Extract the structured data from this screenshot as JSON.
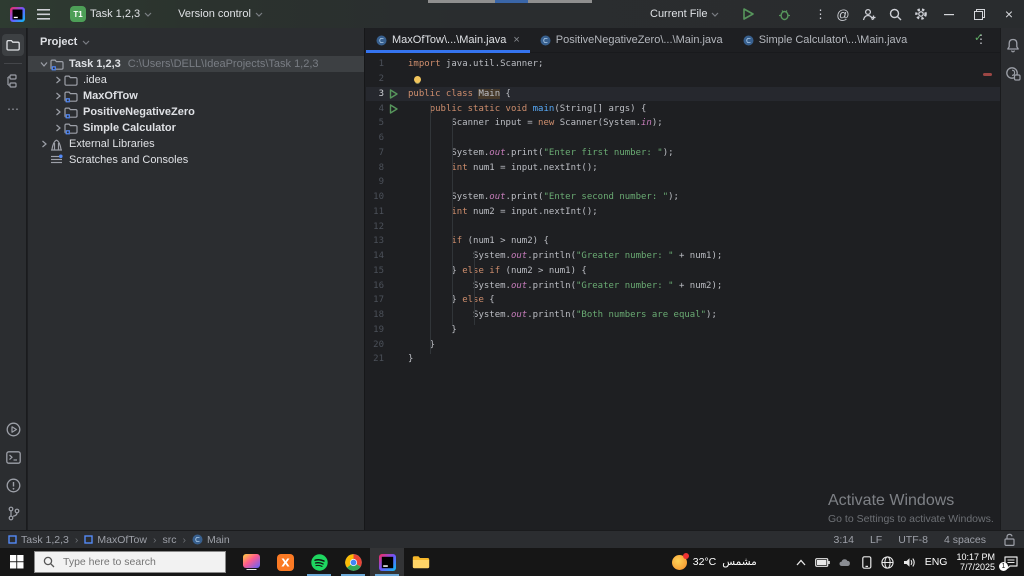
{
  "window": {
    "project_badge": "T1",
    "title_project": "Task 1,2,3",
    "version_control": "Version control",
    "run_config": "Current File",
    "activate_title": "Activate Windows",
    "activate_sub": "Go to Settings to activate Windows.",
    "inspection_check": "✓",
    "kebab": "⋮",
    "more_dots": "⋯",
    "minimize": "—",
    "close": "×"
  },
  "tabs": [
    {
      "label": "MaxOfTow\\...\\Main.java",
      "active": true,
      "closable": true
    },
    {
      "label": "PositiveNegativeZero\\...\\Main.java",
      "active": false,
      "closable": false
    },
    {
      "label": "Simple Calculator\\...\\Main.java",
      "active": false,
      "closable": false
    }
  ],
  "project": {
    "header": "Project",
    "items": [
      {
        "label": "Task 1,2,3",
        "path": "C:\\Users\\DELL\\IdeaProjects\\Task 1,2,3",
        "depth": 0,
        "chevron": "down",
        "icon": "module-folder",
        "bold": true,
        "selected": true
      },
      {
        "label": ".idea",
        "path": "",
        "depth": 1,
        "chevron": "right",
        "icon": "folder",
        "bold": false,
        "selected": false
      },
      {
        "label": "MaxOfTow",
        "path": "",
        "depth": 1,
        "chevron": "right",
        "icon": "module-folder",
        "bold": true,
        "selected": false
      },
      {
        "label": "PositiveNegativeZero",
        "path": "",
        "depth": 1,
        "chevron": "right",
        "icon": "module-folder",
        "bold": true,
        "selected": false
      },
      {
        "label": "Simple Calculator",
        "path": "",
        "depth": 1,
        "chevron": "right",
        "icon": "module-folder",
        "bold": true,
        "selected": false
      },
      {
        "label": "External Libraries",
        "path": "",
        "depth": 0,
        "chevron": "right",
        "icon": "library",
        "bold": false,
        "selected": false
      },
      {
        "label": "Scratches and Consoles",
        "path": "",
        "depth": 0,
        "chevron": "none",
        "icon": "scratch",
        "bold": false,
        "selected": false
      }
    ]
  },
  "editor": {
    "lines": [
      {
        "n": 1,
        "tokens": [
          [
            "k",
            "import"
          ],
          [
            "d",
            " java.util.Scanner;"
          ]
        ]
      },
      {
        "n": 2,
        "bulb": true,
        "tokens": []
      },
      {
        "n": 3,
        "run": true,
        "current": true,
        "tokens": [
          [
            "k",
            "public class "
          ],
          [
            "hl",
            "Main"
          ],
          [
            "d",
            " {"
          ]
        ]
      },
      {
        "n": 4,
        "run": true,
        "tokens": [
          [
            "d",
            "    "
          ],
          [
            "k",
            "public static void "
          ],
          [
            "m",
            "main"
          ],
          [
            "d",
            "(String[] args) {"
          ]
        ]
      },
      {
        "n": 5,
        "tokens": [
          [
            "d",
            "        Scanner input = "
          ],
          [
            "k",
            "new"
          ],
          [
            "d",
            " Scanner(System."
          ],
          [
            "f",
            "in"
          ],
          [
            "d",
            ");"
          ]
        ]
      },
      {
        "n": 6,
        "tokens": []
      },
      {
        "n": 7,
        "tokens": [
          [
            "d",
            "        System."
          ],
          [
            "f",
            "out"
          ],
          [
            "d",
            ".print("
          ],
          [
            "s",
            "\"Enter first number: \""
          ],
          [
            "d",
            ");"
          ]
        ]
      },
      {
        "n": 8,
        "tokens": [
          [
            "d",
            "        "
          ],
          [
            "k",
            "int"
          ],
          [
            "d",
            " num1 = input.nextInt();"
          ]
        ]
      },
      {
        "n": 9,
        "tokens": []
      },
      {
        "n": 10,
        "tokens": [
          [
            "d",
            "        System."
          ],
          [
            "f",
            "out"
          ],
          [
            "d",
            ".print("
          ],
          [
            "s",
            "\"Enter second number: \""
          ],
          [
            "d",
            ");"
          ]
        ]
      },
      {
        "n": 11,
        "tokens": [
          [
            "d",
            "        "
          ],
          [
            "k",
            "int"
          ],
          [
            "d",
            " num2 = input.nextInt();"
          ]
        ]
      },
      {
        "n": 12,
        "tokens": []
      },
      {
        "n": 13,
        "tokens": [
          [
            "d",
            "        "
          ],
          [
            "k",
            "if"
          ],
          [
            "d",
            " (num1 > num2) {"
          ]
        ]
      },
      {
        "n": 14,
        "tokens": [
          [
            "d",
            "            System."
          ],
          [
            "f",
            "out"
          ],
          [
            "d",
            ".println("
          ],
          [
            "s",
            "\"Greater number: \""
          ],
          [
            "d",
            " + num1);"
          ]
        ]
      },
      {
        "n": 15,
        "tokens": [
          [
            "d",
            "        } "
          ],
          [
            "k",
            "else if"
          ],
          [
            "d",
            " (num2 > num1) {"
          ]
        ]
      },
      {
        "n": 16,
        "tokens": [
          [
            "d",
            "            System."
          ],
          [
            "f",
            "out"
          ],
          [
            "d",
            ".println("
          ],
          [
            "s",
            "\"Greater number: \""
          ],
          [
            "d",
            " + num2);"
          ]
        ]
      },
      {
        "n": 17,
        "tokens": [
          [
            "d",
            "        } "
          ],
          [
            "k",
            "else"
          ],
          [
            "d",
            " {"
          ]
        ]
      },
      {
        "n": 18,
        "tokens": [
          [
            "d",
            "            System."
          ],
          [
            "f",
            "out"
          ],
          [
            "d",
            ".println("
          ],
          [
            "s",
            "\"Both numbers are equal\""
          ],
          [
            "d",
            ");"
          ]
        ]
      },
      {
        "n": 19,
        "tokens": [
          [
            "d",
            "        }"
          ]
        ]
      },
      {
        "n": 20,
        "tokens": [
          [
            "d",
            "    }"
          ]
        ]
      },
      {
        "n": 21,
        "tokens": [
          [
            "d",
            "}"
          ]
        ]
      }
    ]
  },
  "status": {
    "breadcrumbs": [
      {
        "label": "Task 1,2,3",
        "icon": "module"
      },
      {
        "label": "MaxOfTow",
        "icon": "module"
      },
      {
        "label": "src",
        "icon": "none"
      },
      {
        "label": "Main",
        "icon": "class"
      }
    ],
    "right_items": [
      "3:14",
      "LF",
      "UTF-8",
      "4 spaces"
    ]
  },
  "taskbar": {
    "search_placeholder": "Type here to search",
    "apps": [
      {
        "name": "colorful-app",
        "running": false,
        "active": false
      },
      {
        "name": "xampp",
        "running": false,
        "active": false
      },
      {
        "name": "spotify",
        "running": true,
        "active": false
      },
      {
        "name": "chrome",
        "running": true,
        "active": false
      },
      {
        "name": "intellij-idea",
        "running": true,
        "active": true
      },
      {
        "name": "file-explorer",
        "running": false,
        "active": false
      }
    ],
    "weather_temp": "32°C",
    "weather_text": "مشمس",
    "lang": "ENG",
    "time": "10:17 PM",
    "date": "7/7/2025",
    "notif_count": "1"
  },
  "colors": {
    "accent": "#3574f0",
    "run_green": "#57965c",
    "keyword": "#cf8e6d",
    "string": "#6aab73",
    "field": "#c77dbb",
    "method": "#56a8f5",
    "error_stripe": "#c75450",
    "taskbar_underline": "#6ca9d8"
  }
}
